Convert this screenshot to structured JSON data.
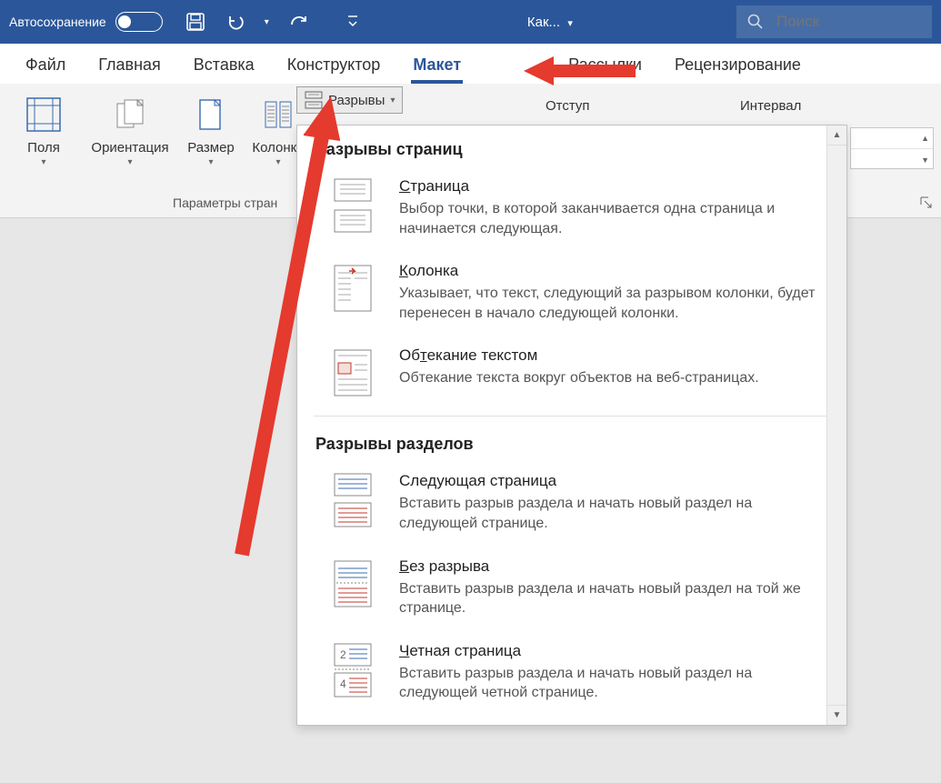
{
  "titlebar": {
    "autosave_label": "Автосохранение",
    "document_label": "Как...",
    "search_placeholder": "Поиск"
  },
  "tabs": {
    "file": "Файл",
    "home": "Главная",
    "insert": "Вставка",
    "design": "Конструктор",
    "layout": "Макет",
    "mail": "Рассылки",
    "review": "Рецензирование"
  },
  "ribbon": {
    "margins": "Поля",
    "orientation": "Ориентация",
    "size": "Размер",
    "columns": "Колонки",
    "breaks": "Разрывы",
    "page_setup_label": "Параметры стран",
    "indent_label": "Отступ",
    "spacing_label": "Интервал"
  },
  "dropdown": {
    "section_page_header": "Разрывы страниц",
    "section_section_header": "Разрывы разделов",
    "items": [
      {
        "title_pre": "",
        "title_u": "С",
        "title_post": "траница",
        "desc": "Выбор точки, в которой заканчивается одна страница и начинается следующая."
      },
      {
        "title_pre": "",
        "title_u": "К",
        "title_post": "олонка",
        "desc": "Указывает, что текст, следующий за разрывом колонки, будет перенесен в начало следующей колонки."
      },
      {
        "title_pre": "Об",
        "title_u": "т",
        "title_post": "екание текстом",
        "desc": "Обтекание текста вокруг объектов на веб-страницах."
      },
      {
        "title_pre": "Следующая страница",
        "title_u": "",
        "title_post": "",
        "desc": "Вставить разрыв раздела и начать новый раздел на следующей странице."
      },
      {
        "title_pre": "",
        "title_u": "Б",
        "title_post": "ез разрыва",
        "desc": "Вставить разрыв раздела и начать новый раздел на той же странице."
      },
      {
        "title_pre": "",
        "title_u": "Ч",
        "title_post": "етная страница",
        "desc": "Вставить разрыв раздела и начать новый раздел на следующей четной странице."
      }
    ]
  },
  "annotations": {
    "arrow_color": "#e53a2e"
  }
}
